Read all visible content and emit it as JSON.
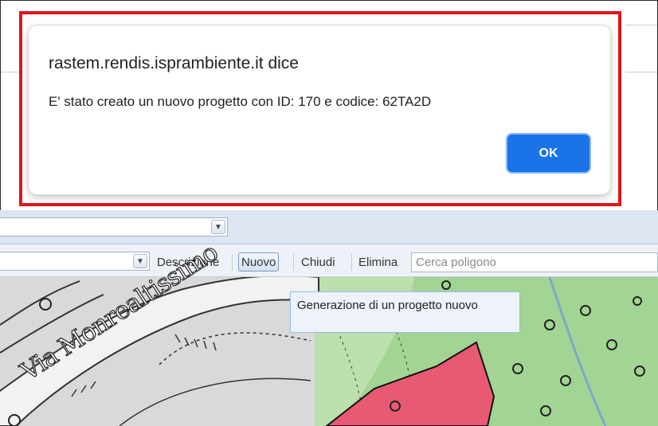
{
  "dialog": {
    "origin": "rastem.rendis.isprambiente.it dice",
    "message": "E' stato creato un nuovo progetto con ID: 170 e codice: 62TA2D",
    "ok_label": "OK"
  },
  "toolbar": {
    "descrizione_label": "Descrizione",
    "buttons": {
      "nuovo": "Nuovo",
      "chiudi": "Chiudi",
      "elimina": "Elimina"
    },
    "search_placeholder": "Cerca poligono"
  },
  "map": {
    "street_label": "Via Monrealtissimo",
    "tooltip": "Generazione di un progetto nuovo"
  },
  "colors": {
    "highlight": "#e0141b",
    "ok_button": "#1a73e8",
    "polygon_fill": "#e85a73",
    "green_area": "#9dd18d"
  },
  "icons": [
    "chevron-down-icon",
    "chevron-down-icon"
  ]
}
